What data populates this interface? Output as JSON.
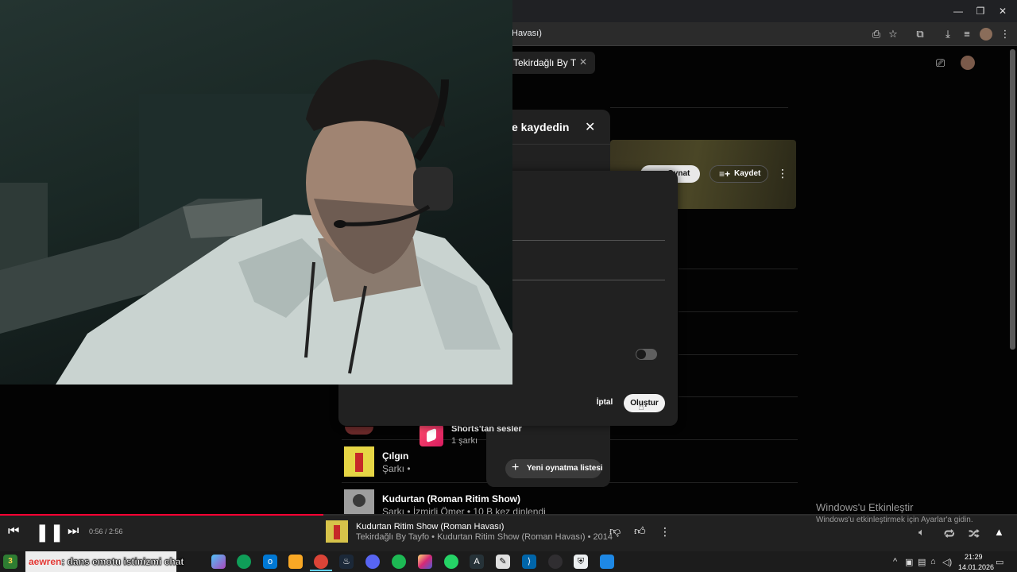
{
  "browser": {
    "url_text": "Havası)",
    "window_controls": [
      "—",
      "❐",
      "✕"
    ]
  },
  "search": {
    "chip_text": "Tekirdağlı By T"
  },
  "hero": {
    "play_label": "Oynat",
    "save_label": "Kaydet"
  },
  "save_dialog": {
    "title": "e kaydedin",
    "playlists": [
      {
        "title": "Shorts'tan sesler",
        "subtitle": "1 şarkı"
      }
    ],
    "new_playlist_label": "Yeni oynatma listesi"
  },
  "new_playlist_dialog": {
    "cancel_label": "İptal",
    "create_label": "Oluştur",
    "toggle_on": false
  },
  "songs": [
    {
      "title": "Çılgın",
      "subtitle": "Şarkı •"
    },
    {
      "title": "Kudurtan (Roman Ritim Show)",
      "subtitle": "Şarkı • İzmirli Ömer • 10 B kez dinlendi"
    }
  ],
  "player": {
    "time": "0:56 / 2:56",
    "progress_fraction": 0.318,
    "track_title": "Kudurtan Ritim Show (Roman Havası)",
    "track_subtitle": "Tekirdağlı By Tayfo • Kudurtan Ritim Show (Roman Havası) • 2014"
  },
  "windows_watermark": {
    "title": "Windows'u Etkinleştir",
    "subtitle": "Windows'u etkinleştirmek için Ayarlar'a gidin."
  },
  "chat_overlay": {
    "user": "aewren",
    "message": ": dans emotu istinizmi chat"
  },
  "taskbar": {
    "time": "21:29",
    "date": "14.01.2026"
  },
  "colors": {
    "accent": "#ff0033",
    "background": "#030303",
    "dialog": "#212121"
  }
}
